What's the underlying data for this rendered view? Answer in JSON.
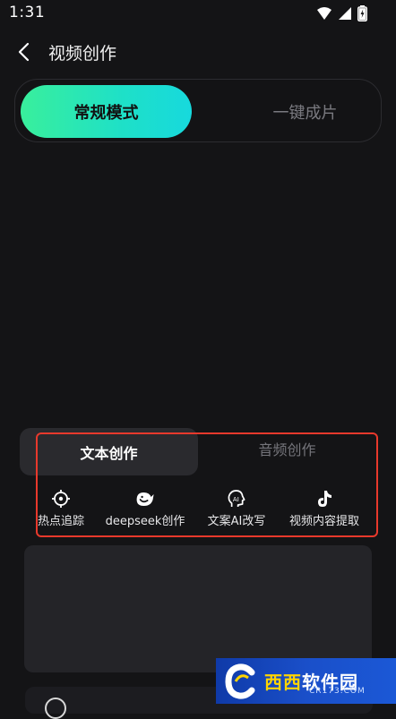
{
  "status_bar": {
    "time": "1:31",
    "icons": [
      "wifi-icon",
      "signal-icon",
      "battery-charging-icon"
    ]
  },
  "header": {
    "back_icon": "chevron-left-icon",
    "title": "视频创作"
  },
  "mode_switch": {
    "tabs": [
      {
        "label": "常规模式",
        "active": true
      },
      {
        "label": "一键成片",
        "active": false
      }
    ],
    "accent_gradient": [
      "#39ef9c",
      "#17d9dd"
    ]
  },
  "content_tabs": [
    {
      "label": "文本创作",
      "active": true
    },
    {
      "label": "音频创作",
      "active": false
    }
  ],
  "tools": [
    {
      "label": "热点追踪",
      "icon": "crosshair-target-icon"
    },
    {
      "label": "deepseek创作",
      "icon": "whale-icon"
    },
    {
      "label": "文案AI改写",
      "icon": "ai-head-icon"
    },
    {
      "label": "视频内容提取",
      "icon": "tiktok-note-icon"
    }
  ],
  "highlight_color": "#e8392c",
  "watermark": {
    "brand_a": "西西",
    "brand_b": "软件园",
    "domain": "CR173.COM"
  }
}
